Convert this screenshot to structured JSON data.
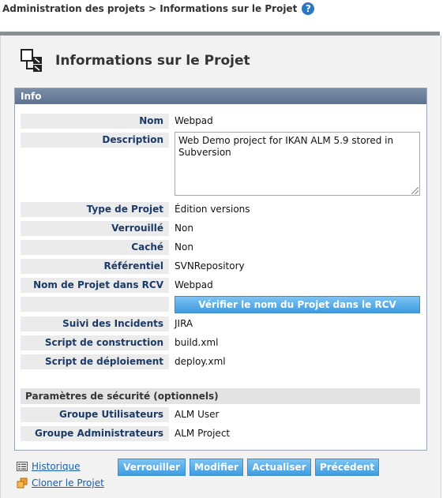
{
  "breadcrumb": {
    "text": "Administration des projets > Informations sur le Projet",
    "help_icon": "?"
  },
  "header": {
    "title": "Informations sur le Projet",
    "icon": "project-structure-icon"
  },
  "info": {
    "section_title": "Info",
    "fields": [
      {
        "label": "Nom",
        "value": "Webpad"
      },
      {
        "label": "Description",
        "value": "Web Demo project for IKAN ALM 5.9 stored in Subversion"
      },
      {
        "label": "Type de Projet",
        "value": "Édition versions"
      },
      {
        "label": "Verrouillé",
        "value": "Non"
      },
      {
        "label": "Caché",
        "value": "Non"
      },
      {
        "label": "Référentiel",
        "value": "SVNRepository"
      },
      {
        "label": "Nom de Projet dans RCV",
        "value": "Webpad"
      },
      {
        "label": "",
        "value": ""
      },
      {
        "label": "Suivi des Incidents",
        "value": "JIRA"
      },
      {
        "label": "Script de construction",
        "value": "build.xml"
      },
      {
        "label": "Script de déploiement",
        "value": "deploy.xml"
      }
    ],
    "verify_button": "Vérifier le nom du Projet dans le RCV",
    "security_title": "Paramètres de sécurité (optionnels)",
    "security_fields": [
      {
        "label": "Groupe Utilisateurs",
        "value": "ALM User"
      },
      {
        "label": "Groupe Administrateurs",
        "value": "ALM Project"
      }
    ]
  },
  "footer": {
    "history_link": "Historique",
    "clone_link": "Cloner le Projet",
    "buttons": {
      "lock": "Verrouiller",
      "edit": "Modifier",
      "refresh": "Actualiser",
      "back": "Précédent"
    }
  },
  "colors": {
    "accent": "#3e9ce0",
    "header": "#5d7290",
    "label_text": "#1b3a66",
    "link": "#1a5fa8"
  }
}
